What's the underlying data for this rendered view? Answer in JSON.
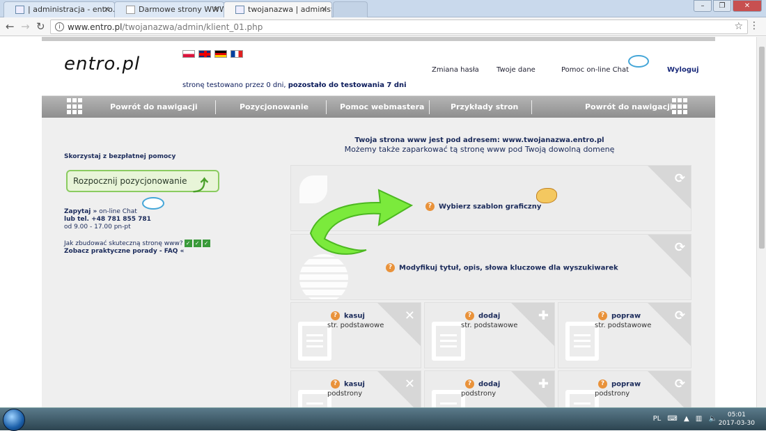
{
  "tabs": [
    {
      "title": "| administracja - entro.pl"
    },
    {
      "title": "Darmowe strony WWW, b"
    },
    {
      "title": "twojanazwa | administrac"
    }
  ],
  "address": {
    "host": "www.entro.pl",
    "path": "/twojanazwa/admin/klient_01.php"
  },
  "header": {
    "logo": "entro.pl",
    "trial_prefix": "stronę testowano przez 0 dni, ",
    "trial_bold": "pozostało do testowania 7 dni",
    "links": {
      "change_password": "Zmiana hasła",
      "your_data": "Twoje dane",
      "help_chat": "Pomoc on-line Chat",
      "logout": "Wyloguj"
    }
  },
  "nav": {
    "left_back": "Powrót do nawigacji",
    "positioning": "Pozycjonowanie",
    "webmaster_help": "Pomoc webmastera",
    "examples": "Przykłady stron",
    "right_back": "Powrót do nawigacji"
  },
  "site_address": {
    "line1": "Twoja strona www jest pod adresem: www.twojanazwa.entro.pl",
    "line2": "Możemy także zaparkować tą stronę www pod Twoją dowolną domenę"
  },
  "sidebar": {
    "help_title": "Skorzystaj z bezpłatnej pomocy",
    "start_button": "Rozpocznij pozycjonowanie",
    "ask": "Zapytaj »",
    "ask_rest": " on-line Chat",
    "phone": "lub tel. +48 781 855 781",
    "hours": "od 9.00 - 17.00 pn-pt",
    "howto": "Jak zbudować skuteczną stronę www?",
    "faq": "Zobacz praktyczne porady - FAQ «"
  },
  "panels": {
    "template": "Wybierz szablon graficzny",
    "seo": "Modyfikuj tytuł, opis, słowa kluczowe dla wyszukiwarek",
    "row1": [
      {
        "title": "kasuj",
        "sub": "str. podstawowe"
      },
      {
        "title": "dodaj",
        "sub": "str. podstawowe"
      },
      {
        "title": "popraw",
        "sub": "str. podstawowe"
      }
    ],
    "row2": [
      {
        "title": "kasuj",
        "sub": "podstrony"
      },
      {
        "title": "dodaj",
        "sub": "podstrony"
      },
      {
        "title": "popraw",
        "sub": "podstrony"
      }
    ]
  },
  "taskbar": {
    "lang": "PL",
    "time": "05:01",
    "date": "2017-03-30"
  },
  "colors": {
    "navbar": "#9e9e9e",
    "accent_green": "#4aa02a",
    "question": "#e9923a",
    "text_dark": "#1a2a5a"
  }
}
